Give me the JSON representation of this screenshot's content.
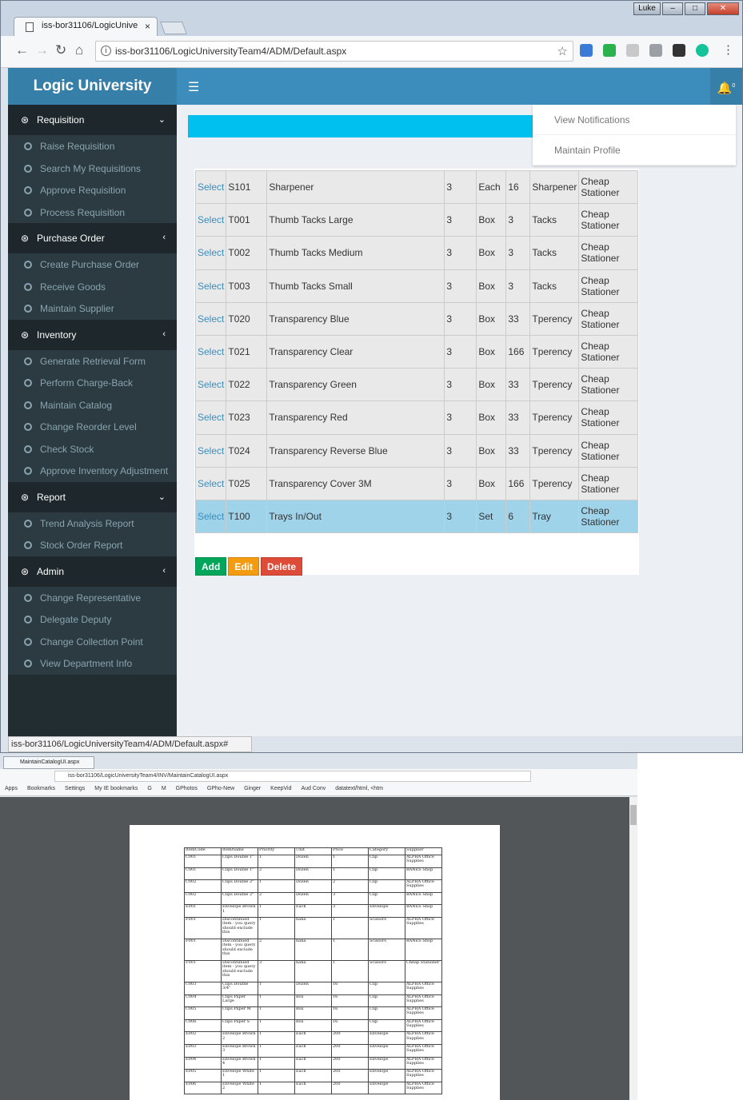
{
  "browser": {
    "tab_title": "iss-bor31106/LogicUnive",
    "tab_close": "×",
    "window_user_badge": "Luke",
    "url": "iss-bor31106/LogicUniversityTeam4/ADM/Default.aspx",
    "status_url": "iss-bor31106/LogicUniversityTeam4/ADM/Default.aspx#"
  },
  "app": {
    "brand": "Logic University",
    "notification_count": "0"
  },
  "sidebar": {
    "sections": [
      {
        "label": "Requisition",
        "chevron": "⌄",
        "items": [
          "Raise Requisition",
          "Search My Requisitions",
          "Approve Requisition",
          "Process Requisition"
        ]
      },
      {
        "label": "Purchase Order",
        "chevron": "‹",
        "items": [
          "Create Purchase Order",
          "Receive Goods",
          "Maintain Supplier"
        ]
      },
      {
        "label": "Inventory",
        "chevron": "‹",
        "items": [
          "Generate Retrieval Form",
          "Perform Charge-Back",
          "Maintain Catalog",
          "Change Reorder Level",
          "Check Stock",
          "Approve Inventory Adjustment"
        ]
      },
      {
        "label": "Report",
        "chevron": "⌄",
        "items": [
          "Trend Analysis Report",
          "Stock Order Report"
        ]
      },
      {
        "label": "Admin",
        "chevron": "‹",
        "items": [
          "Change Representative",
          "Delegate Deputy",
          "Change Collection Point",
          "View Department Info"
        ]
      }
    ]
  },
  "dropdown": {
    "items": [
      "View Notifications",
      "Maintain Profile"
    ]
  },
  "catalog": {
    "select_label": "Select",
    "rows": [
      [
        "S101",
        "Sharpener",
        "3",
        "Each",
        "16",
        "Sharpener",
        "Cheap Stationer"
      ],
      [
        "T001",
        "Thumb Tacks Large",
        "3",
        "Box",
        "3",
        "Tacks",
        "Cheap Stationer"
      ],
      [
        "T002",
        "Thumb Tacks Medium",
        "3",
        "Box",
        "3",
        "Tacks",
        "Cheap Stationer"
      ],
      [
        "T003",
        "Thumb Tacks Small",
        "3",
        "Box",
        "3",
        "Tacks",
        "Cheap Stationer"
      ],
      [
        "T020",
        "Transparency Blue",
        "3",
        "Box",
        "33",
        "Tperency",
        "Cheap Stationer"
      ],
      [
        "T021",
        "Transparency Clear",
        "3",
        "Box",
        "166",
        "Tperency",
        "Cheap Stationer"
      ],
      [
        "T022",
        "Transparency Green",
        "3",
        "Box",
        "33",
        "Tperency",
        "Cheap Stationer"
      ],
      [
        "T023",
        "Transparency Red",
        "3",
        "Box",
        "33",
        "Tperency",
        "Cheap Stationer"
      ],
      [
        "T024",
        "Transparency Reverse Blue",
        "3",
        "Box",
        "33",
        "Tperency",
        "Cheap Stationer"
      ],
      [
        "T025",
        "Transparency Cover 3M",
        "3",
        "Box",
        "166",
        "Tperency",
        "Cheap Stationer"
      ],
      [
        "T100",
        "Trays In/Out",
        "3",
        "Set",
        "6",
        "Tray",
        "Cheap Stationer"
      ]
    ],
    "selected_row": 10,
    "buttons": {
      "add": "Add",
      "edit": "Edit",
      "delete": "Delete"
    }
  },
  "browser2": {
    "tab_title": "MaintainCatalogUI.aspx",
    "url": "iss-bor31106/LogicUniversityTeam4/INV/MaintainCatalogUI.aspx",
    "bookmarks": [
      "Apps",
      "Bookmarks",
      "Settings",
      "My IE bookmarks",
      "G",
      "M",
      "GPhotos",
      "GPho-New",
      "Ginger",
      "KeepVid",
      "Aud Conv",
      "datatext/html, <htm"
    ]
  },
  "print_table": {
    "headers": [
      "ItemCode",
      "ItemName",
      "Priority",
      "Unit",
      "Price",
      "Category",
      "Supplier"
    ],
    "rows": [
      [
        "C001",
        "Clips Double 1\"",
        "1",
        "Dozen",
        "1",
        "Clip",
        "ALPHA Office Supplies"
      ],
      [
        "C001",
        "Clips Double 1\"",
        "2",
        "Dozen",
        "1",
        "Clip",
        "BANES Shop"
      ],
      [
        "C002",
        "Clips Double 2\"",
        "1",
        "Dozen",
        "2",
        "Clip",
        "ALPHA Office Supplies"
      ],
      [
        "C002",
        "Clips Double 2\"",
        "2",
        "Dozen",
        "3",
        "Clip",
        "BANES Shop"
      ],
      [
        "E001",
        "Envelope Brown 1",
        "1",
        "Each",
        "3",
        "Envelope",
        "BANES Shop"
      ],
      [
        "F001",
        "Discontinued item - you query should exclude this",
        "1",
        "haha",
        "1",
        "Scissors",
        "ALPHA Office Supplies"
      ],
      [
        "F001",
        "Discontinued item - you query should exclude this",
        "2",
        "haha",
        "1",
        "Scissors",
        "BANES Shop"
      ],
      [
        "F001",
        "Discontinued item - you query should exclude this",
        "3",
        "haha",
        "1",
        "Scissors",
        "Cheap Stationer"
      ],
      [
        "C003",
        "Clips Double 3/4\"",
        "1",
        "Dozen",
        "16",
        "Clip",
        "ALPHA Office Supplies"
      ],
      [
        "C004",
        "Clips Paper Large",
        "1",
        "Box",
        "16",
        "Clip",
        "ALPHA Office Supplies"
      ],
      [
        "C005",
        "Clips Paper M",
        "1",
        "Box",
        "16",
        "Clip",
        "ALPHA Office Supplies"
      ],
      [
        "C006",
        "Clips Paper S",
        "1",
        "Box",
        "16",
        "Clip",
        "ALPHA Office Supplies"
      ],
      [
        "E002",
        "Envelope Brown 2",
        "1",
        "Each",
        "200",
        "Envelope",
        "ALPHA Office Supplies"
      ],
      [
        "E003",
        "Envelope Brown 3",
        "1",
        "Each",
        "200",
        "Envelope",
        "ALPHA Office Supplies"
      ],
      [
        "E004",
        "Envelope Brown 4",
        "1",
        "Each",
        "200",
        "Envelope",
        "ALPHA Office Supplies"
      ],
      [
        "E005",
        "Envelope White 1",
        "1",
        "Each",
        "200",
        "Envelope",
        "ALPHA Office Supplies"
      ],
      [
        "E006",
        "Envelope White 2",
        "1",
        "Each",
        "200",
        "Envelope",
        "ALPHA Office Supplies"
      ]
    ]
  },
  "colors": {
    "brand_blue": "#367fa9",
    "header_blue": "#3c8dbc",
    "sidebar_dark": "#222d32",
    "info_bar": "#00c0ef",
    "btn_add": "#00a65a",
    "btn_edit": "#f39c12",
    "btn_delete": "#dd4b39",
    "selected_row": "#9fd3ea"
  },
  "icons": [
    "back-arrow-icon",
    "forward-arrow-icon",
    "reload-icon",
    "home-icon",
    "info-icon",
    "star-icon",
    "menu-icon",
    "bell-icon",
    "dashboard-icon",
    "circle-icon",
    "chevron-icon"
  ]
}
